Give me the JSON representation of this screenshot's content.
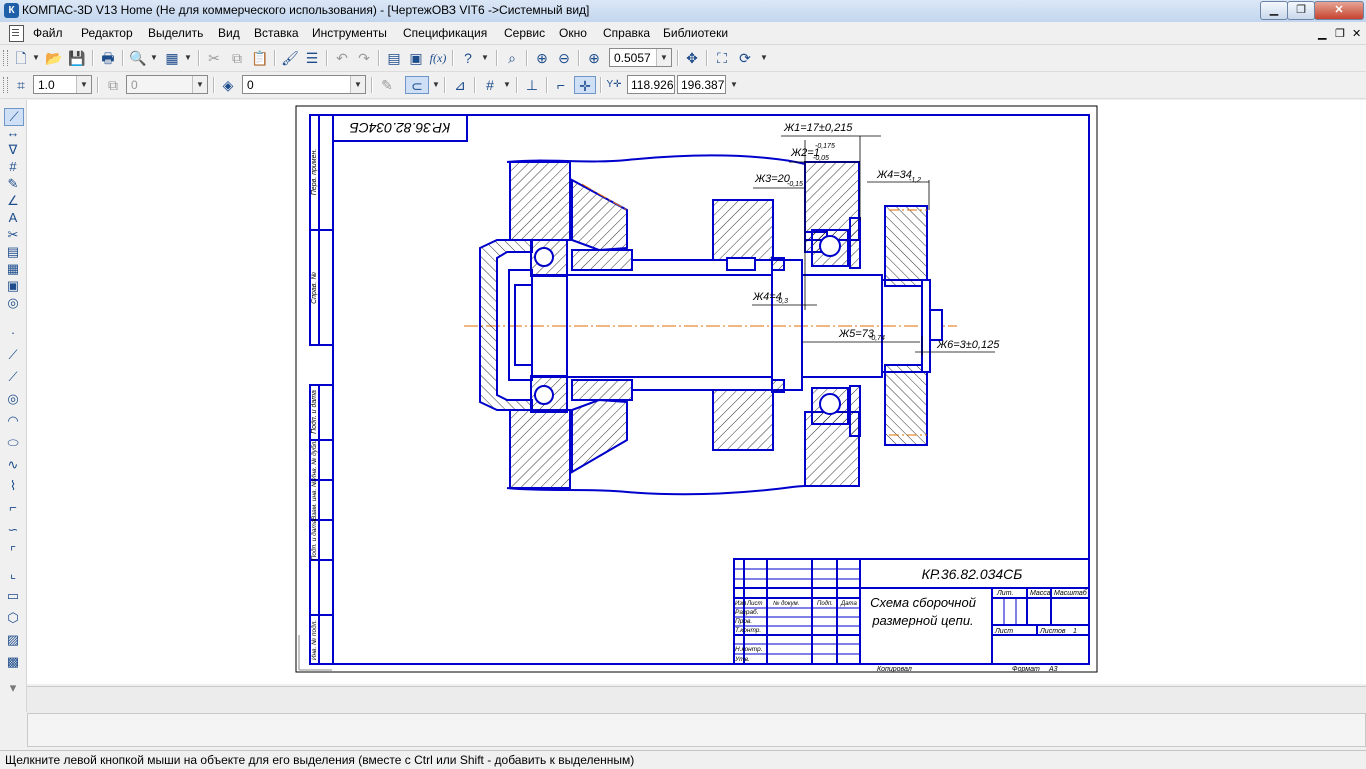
{
  "window": {
    "title": "КОМПАС-3D V13 Home (Не для коммерческого использования) - [ЧертежОВЗ VIT6 ->Системный вид]",
    "app_icon": "К"
  },
  "menu": {
    "items": [
      "Файл",
      "Редактор",
      "Выделить",
      "Вид",
      "Вставка",
      "Инструменты",
      "Спецификация",
      "Сервис",
      "Окно",
      "Справка",
      "Библиотеки"
    ]
  },
  "toolbar1": {
    "zoom_value": "0.5057"
  },
  "toolbar2": {
    "line_step": "1.0",
    "layer_value": "0",
    "style_value": "0",
    "coord_x": "118.926",
    "coord_y": "196.387"
  },
  "drawing": {
    "stamp_code": "КР.36.82.034СБ",
    "stamp_code_mirrored": "КР.36.82.034СБ",
    "title_line1": "Схема сборочной",
    "title_line2": "размерной цепи.",
    "cols": [
      "Изм",
      "Лист",
      "№ докум.",
      "Подп.",
      "Дата"
    ],
    "roles": [
      "Разраб.",
      "Пров.",
      "Т.контр.",
      "Н.контр.",
      "Утв."
    ],
    "lit_label": "Лит.",
    "mass_label": "Масса",
    "scale_label": "Масштаб",
    "sheet_label": "Лист",
    "sheets_label": "Листов",
    "sheets_value": "1",
    "copied_label": "Копировал",
    "format_label": "Формат",
    "format_value": "А3",
    "side_labels": [
      "Перв. примен.",
      "Справ. №",
      "Подп. и дата",
      "Инв. № дубл.",
      "Взам. инв. №",
      "Подп. и дата",
      "Инв. № подл."
    ],
    "dims": {
      "zh1": "Ж1=17±0,215",
      "zh2": "Ж2=1",
      "zh2_sup": "-0,175",
      "zh2_sub": "-0,05",
      "zh3": "Ж3=20",
      "zh3_sub": "-0,15",
      "zh4": "Ж4=34",
      "zh4_sub": "-1,2",
      "zh_small": "Ж4=4",
      "zh_small_sub": "-0,3",
      "zh5": "Ж5=73",
      "zh5_sub": "-0,74",
      "zh6": "Ж6=3±0,125"
    }
  },
  "status": {
    "text": "Щелкните левой кнопкой мыши на объекте для его выделения (вместе с Ctrl или Shift - добавить к выделенным)"
  }
}
